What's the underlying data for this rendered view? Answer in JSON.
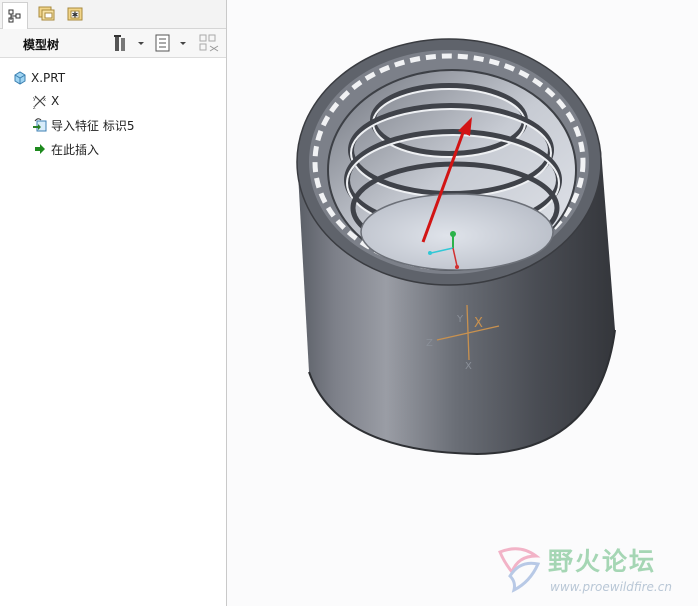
{
  "panel_tabs": [
    {
      "icon": "model-tree-icon"
    },
    {
      "icon": "folder-browser-icon"
    },
    {
      "icon": "favorites-icon"
    }
  ],
  "tree_header": {
    "title": "模型树",
    "settings_icon": "tree-settings-icon",
    "columns_icon": "tree-columns-icon",
    "filter_icon": "tree-filter-icon"
  },
  "tree": {
    "root": {
      "label": "X.PRT",
      "icon": "part-icon"
    },
    "items": [
      {
        "label": "X",
        "icon": "coordinate-system-icon"
      },
      {
        "label": "导入特征 标识5",
        "icon": "import-feature-icon"
      },
      {
        "label": "在此插入",
        "icon": "insert-here-arrow-icon"
      }
    ]
  },
  "viewport": {
    "csys_label": "X",
    "axis_labels": {
      "y": "Y",
      "z": "Z",
      "x": "X"
    }
  },
  "watermark": {
    "cn": "野火论坛",
    "url": "www.proewildfire.cn"
  },
  "colors": {
    "cylinder_dark": "#43464d",
    "cylinder_light": "#8d9099",
    "arrow": "#d21414",
    "csys": "#c8914f",
    "watermark_green": "#a5d6b4"
  }
}
